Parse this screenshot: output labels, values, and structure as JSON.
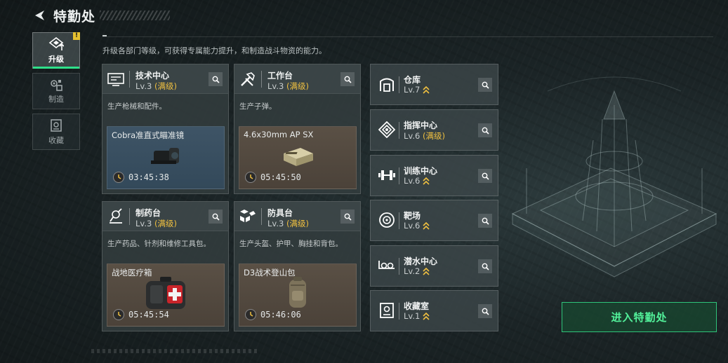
{
  "header": {
    "title": "特勤处"
  },
  "sidebar": {
    "items": [
      {
        "label": "升级",
        "icon": "upgrade-icon",
        "active": true,
        "badge": "!"
      },
      {
        "label": "制造",
        "icon": "craft-icon",
        "active": false
      },
      {
        "label": "收藏",
        "icon": "collection-icon",
        "active": false
      }
    ]
  },
  "subtitle": "升级各部门等级，可获得专属能力提升，和制造战斗物资的能力。",
  "production": [
    {
      "name": "技术中心",
      "level": "Lv.3",
      "max_tag": "(满级)",
      "desc": "生产枪械和配件。",
      "item": "Cobra准直式瞄准镜",
      "timer": "03:45:38",
      "slot_color": "blue",
      "icon": "tech-center-icon",
      "item_icon": "scope-icon"
    },
    {
      "name": "工作台",
      "level": "Lv.3",
      "max_tag": "(满级)",
      "desc": "生产子弹。",
      "item": "4.6x30mm AP SX",
      "timer": "05:45:50",
      "slot_color": "brown",
      "icon": "workbench-icon",
      "item_icon": "ammo-box-icon"
    },
    {
      "name": "制药台",
      "level": "Lv.3",
      "max_tag": "(满级)",
      "desc": "生产药品、针剂和维修工具包。",
      "item": "战地医疗箱",
      "timer": "05:45:54",
      "slot_color": "brown",
      "icon": "pharmacy-icon",
      "item_icon": "medkit-icon"
    },
    {
      "name": "防具台",
      "level": "Lv.3",
      "max_tag": "(满级)",
      "desc": "生产头盔、护甲、胸挂和背包。",
      "item": "D3战术登山包",
      "timer": "05:46:06",
      "slot_color": "brown",
      "icon": "armor-bench-icon",
      "item_icon": "backpack-icon"
    }
  ],
  "facilities": [
    {
      "name": "仓库",
      "level": "Lv.7",
      "max_tag": "",
      "upgradable": true,
      "icon": "warehouse-icon"
    },
    {
      "name": "指挥中心",
      "level": "Lv.6",
      "max_tag": "(满级)",
      "upgradable": false,
      "icon": "command-center-icon"
    },
    {
      "name": "训练中心",
      "level": "Lv.6",
      "max_tag": "",
      "upgradable": true,
      "icon": "training-center-icon"
    },
    {
      "name": "靶场",
      "level": "Lv.6",
      "max_tag": "",
      "upgradable": true,
      "icon": "shooting-range-icon"
    },
    {
      "name": "潜水中心",
      "level": "Lv.2",
      "max_tag": "",
      "upgradable": true,
      "icon": "diving-center-icon"
    },
    {
      "name": "收藏室",
      "level": "Lv.1",
      "max_tag": "",
      "upgradable": true,
      "icon": "collection-room-icon"
    }
  ],
  "enter_button": "进入特勤处",
  "colors": {
    "accent_green": "#2fe08a",
    "max_gold": "#f0c040",
    "slot_blue": "#3e5466",
    "slot_brown": "#5a5045"
  }
}
